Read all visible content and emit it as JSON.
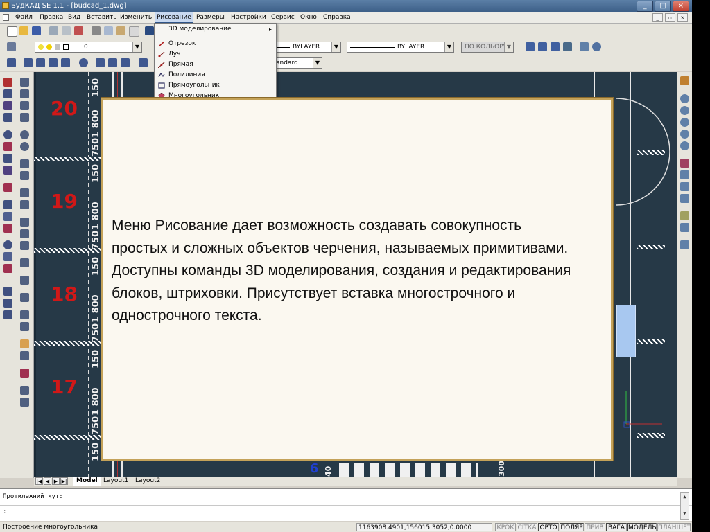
{
  "window": {
    "title": "БудКАД SE 1.1 - [budcad_1.dwg]",
    "controls": [
      "_",
      "□",
      "×"
    ],
    "mdi_controls": [
      "_",
      "▫",
      "×"
    ]
  },
  "menubar": {
    "items": [
      "Файл",
      "Правка",
      "Вид",
      "Вставить",
      "Изменить",
      "Рисование",
      "Размеры",
      "Настройки",
      "Сервис",
      "Окно",
      "Справка"
    ],
    "active": "Рисование"
  },
  "toolbar_properties": {
    "layer_value": "0",
    "linetype_value": "BYLAYER",
    "lineweight_value": "BYLAYER",
    "color_value": "ПО КОЛЬОРУ",
    "textstyle_value": "andard"
  },
  "dropdown": {
    "items": [
      {
        "label": "3D моделирование",
        "icon": "none",
        "has_submenu": true,
        "submenu_glyph": "▸"
      },
      {
        "label": "Отрезок",
        "icon": "line-icon"
      },
      {
        "label": "Луч",
        "icon": "ray-icon"
      },
      {
        "label": "Прямая",
        "icon": "xline-icon"
      },
      {
        "label": "Полилиния",
        "icon": "polyline-icon"
      },
      {
        "label": "Прямоугольник",
        "icon": "rectangle-icon"
      },
      {
        "label": "Многоугольник",
        "icon": "polygon-icon"
      }
    ]
  },
  "drawing": {
    "row_numbers": [
      "20",
      "19",
      "18",
      "17"
    ],
    "dimension_labels": [
      "150",
      "1 800",
      "750",
      "150",
      "1 800",
      "750",
      "150",
      "1 800",
      "750",
      "150",
      "1 800",
      "750",
      "150"
    ],
    "bottom_labels": [
      "6",
      "40",
      "300"
    ]
  },
  "tabs": {
    "nav": [
      "|◀",
      "◀",
      "▶",
      "▶|"
    ],
    "items": [
      "Model",
      "Layout1",
      "Layout2"
    ],
    "active": "Model"
  },
  "command_line": {
    "line1": "Протилежний кут:",
    "line2": ":"
  },
  "statusbar": {
    "status_text": "Построение многоугольника",
    "coordinates": "1163908.4901,156015.3052,0.0000",
    "buttons": [
      {
        "label": "КРОК",
        "on": false
      },
      {
        "label": "СІТКА",
        "on": false
      },
      {
        "label": "ОРТО",
        "on": true
      },
      {
        "label": "ПОЛЯР",
        "on": true
      },
      {
        "label": "ПРИВ",
        "on": false
      },
      {
        "label": "ВАГА",
        "on": true
      },
      {
        "label": "МОДЕЛЬ",
        "on": true
      },
      {
        "label": "ПЛАНШЕТ",
        "on": false
      }
    ]
  },
  "overlay": {
    "text": "Меню Рисование дает возможность создавать совокупность\nпростых и сложных объектов черчения, называемых примитивами.\nДоступны команды 3D моделирования, создания и редактирования\nблоков, штриховки. Присутствует вставка многострочного и\nоднострочного текста."
  },
  "colors": {
    "canvas_bg": "#263947",
    "row_number": "#d01818",
    "overlay_bg": "#fbf8f0",
    "overlay_border": "#c4a259",
    "title_bar": "#4a6e96"
  }
}
